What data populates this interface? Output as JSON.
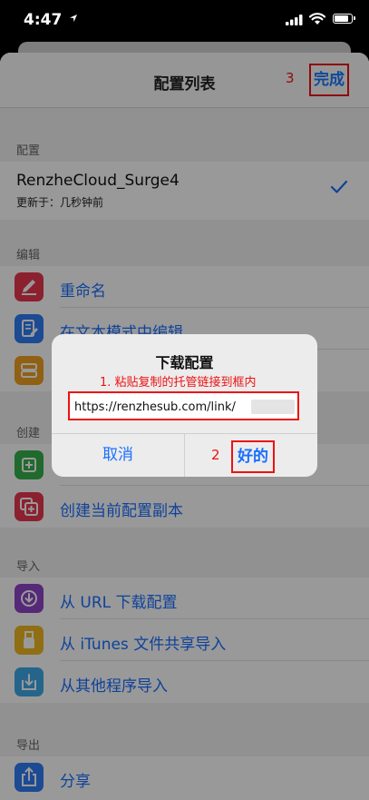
{
  "status_bar": {
    "time": "4:47"
  },
  "nav": {
    "title": "配置列表",
    "done": "完成",
    "step3": "3"
  },
  "sections": {
    "config": "配置",
    "edit": "编辑",
    "create": "创建",
    "import": "导入",
    "export": "导出"
  },
  "config_item": {
    "name": "RenzheCloud_Surge4",
    "updated": "更新于：几秒钟前"
  },
  "edit_items": [
    {
      "label": "重命名",
      "color": "#e8384f"
    },
    {
      "label": "在文本模式中编辑",
      "color": "#2f7cf6"
    },
    {
      "label": "",
      "color": "#f0a020"
    }
  ],
  "create_items": [
    {
      "label": "",
      "color": "#34b14a"
    },
    {
      "label": "创建当前配置副本",
      "color": "#e8384f"
    }
  ],
  "import_items": [
    {
      "label": "从 URL 下载配置",
      "color": "#8e44c9"
    },
    {
      "label": "从 iTunes 文件共享导入",
      "color": "#f0b820"
    },
    {
      "label": "从其他程序导入",
      "color": "#3fa9e8"
    }
  ],
  "export_items": [
    {
      "label": "分享",
      "color": "#2f7cf6"
    }
  ],
  "dialog": {
    "title": "下载配置",
    "annotation1": "1. 粘贴复制的托管链接到框内",
    "url": "https://renzhesub.com/link/",
    "cancel": "取消",
    "ok": "好的",
    "step2": "2"
  },
  "accent_color": "#1a6fff",
  "annotation_color": "#e11111"
}
